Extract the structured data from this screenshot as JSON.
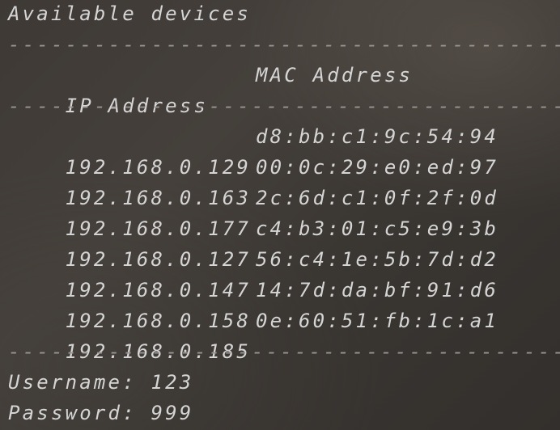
{
  "title": "Available devices",
  "separator": "----------------------------------------",
  "headers": {
    "ip": "IP Address",
    "mac": "MAC Address"
  },
  "devices": [
    {
      "ip": "192.168.0.129",
      "mac": "d8:bb:c1:9c:54:94"
    },
    {
      "ip": "192.168.0.163",
      "mac": "00:0c:29:e0:ed:97"
    },
    {
      "ip": "192.168.0.177",
      "mac": "2c:6d:c1:0f:2f:0d"
    },
    {
      "ip": "192.168.0.127",
      "mac": "c4:b3:01:c5:e9:3b"
    },
    {
      "ip": "192.168.0.147",
      "mac": "56:c4:1e:5b:7d:d2"
    },
    {
      "ip": "192.168.0.158",
      "mac": "14:7d:da:bf:91:d6"
    },
    {
      "ip": "192.168.0.185",
      "mac": "0e:60:51:fb:1c:a1"
    }
  ],
  "credentials": {
    "username": "Username: 123",
    "password": "Password: 999"
  }
}
